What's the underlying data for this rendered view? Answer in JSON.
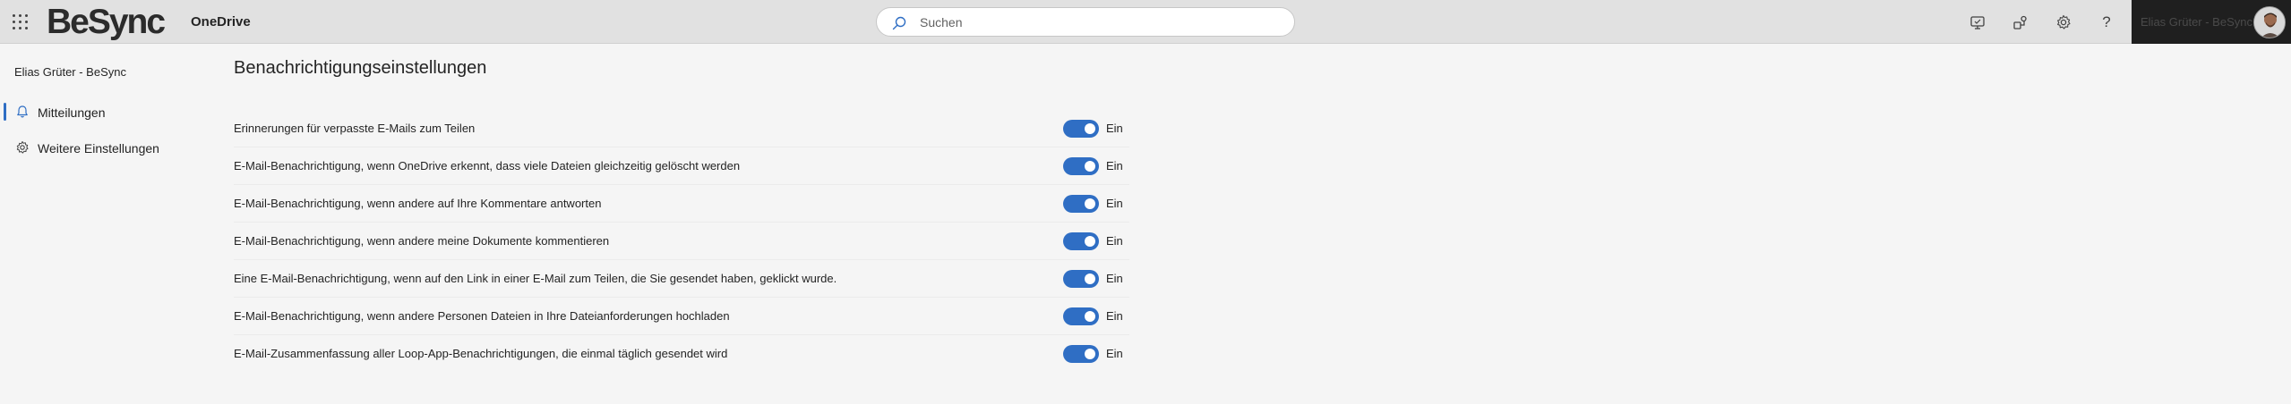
{
  "header": {
    "brand": "BeSync",
    "app_name": "OneDrive",
    "search_placeholder": "Suchen",
    "account_name": "Elias Grüter - BeSync",
    "icons": [
      "waffle-icon",
      "search-icon",
      "whiteboard-icon",
      "share-icon",
      "gear-icon",
      "help-icon"
    ],
    "help_glyph": "?"
  },
  "sidebar": {
    "title": "Elias Grüter - BeSync",
    "items": [
      {
        "label": "Mitteilungen",
        "icon": "bell-icon",
        "active": true
      },
      {
        "label": "Weitere Einstellungen",
        "icon": "gear-icon",
        "active": false
      }
    ]
  },
  "main": {
    "title": "Benachrichtigungseinstellungen",
    "settings": [
      {
        "label": "Erinnerungen für verpasste E-Mails zum Teilen",
        "state": "Ein"
      },
      {
        "label": "E-Mail-Benachrichtigung, wenn OneDrive erkennt, dass viele Dateien gleichzeitig gelöscht werden",
        "state": "Ein"
      },
      {
        "label": "E-Mail-Benachrichtigung, wenn andere auf Ihre Kommentare antworten",
        "state": "Ein"
      },
      {
        "label": "E-Mail-Benachrichtigung, wenn andere meine Dokumente kommentieren",
        "state": "Ein"
      },
      {
        "label": "Eine E-Mail-Benachrichtigung, wenn auf den Link in einer E-Mail zum Teilen, die Sie gesendet haben, geklickt wurde.",
        "state": "Ein"
      },
      {
        "label": "E-Mail-Benachrichtigung, wenn andere Personen Dateien in Ihre Dateianforderungen hochladen",
        "state": "Ein"
      },
      {
        "label": "E-Mail-Zusammenfassung aller Loop-App-Benachrichtigungen, die einmal täglich gesendet wird",
        "state": "Ein"
      }
    ]
  },
  "colors": {
    "accent": "#2f6ec4",
    "header_bg": "#e1e1e1",
    "page_bg": "#f5f5f5"
  }
}
